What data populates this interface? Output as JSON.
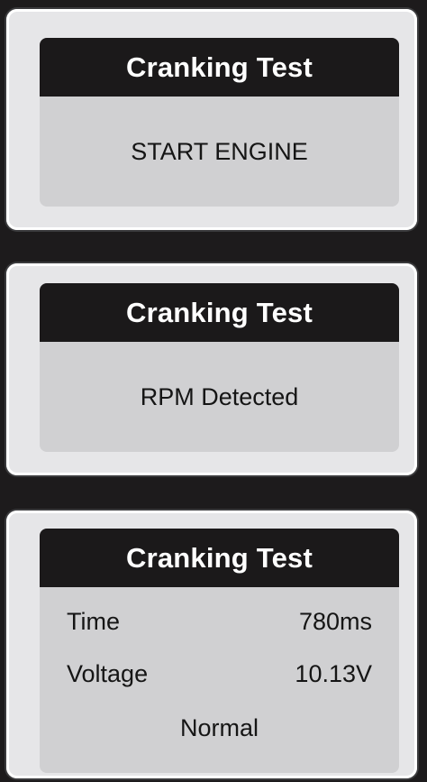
{
  "panels": [
    {
      "title": "Cranking Test",
      "message": "START ENGINE"
    },
    {
      "title": "Cranking Test",
      "message": "RPM Detected"
    },
    {
      "title": "Cranking Test",
      "results": {
        "time_label": "Time",
        "time_value": "780ms",
        "voltage_label": "Voltage",
        "voltage_value": "10.13V",
        "status": "Normal"
      }
    }
  ]
}
